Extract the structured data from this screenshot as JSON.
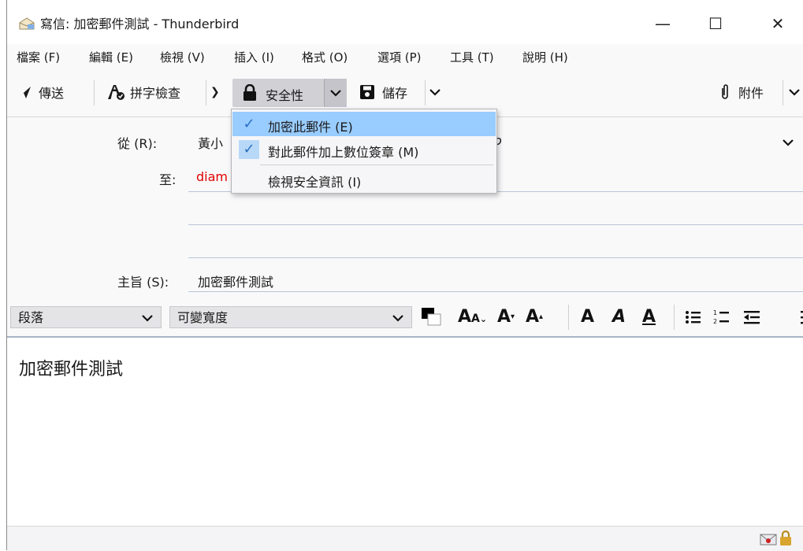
{
  "window": {
    "title": "寫信: 加密郵件測試 - Thunderbird",
    "minimize": "—",
    "maximize": "☐",
    "close": "✕"
  },
  "menubar": {
    "file": "檔案 (F)",
    "edit": "編輯 (E)",
    "view": "檢視 (V)",
    "insert": "插入 (I)",
    "format": "格式 (O)",
    "options": "選項 (P)",
    "tools": "工具 (T)",
    "help": "說明 (H)"
  },
  "toolbar": {
    "send": "傳送",
    "spell": "拼字檢查",
    "security": "安全性",
    "save": "儲存",
    "attach": "附件"
  },
  "security_menu": {
    "encrypt": "加密此郵件 (E)",
    "sign": "對此郵件加上數位簽章 (M)",
    "view_info": "檢視安全資訊 (I)",
    "encrypt_checked": true,
    "sign_checked": true
  },
  "header": {
    "from_label": "從 (R):",
    "from_value": "黃小",
    "from_tail": "o",
    "to_label": "至:",
    "to_value": "diam",
    "subject_label": "主旨 (S):",
    "subject_value": "加密郵件測試"
  },
  "format_bar": {
    "paragraph": "段落",
    "font": "可變寬度"
  },
  "body": {
    "text": "加密郵件測試"
  },
  "colors": {
    "accent": "#2a6fbf",
    "highlight": "#99ccff",
    "recipient": "#e00000",
    "toolbar_bg": "#f9f9fa"
  }
}
